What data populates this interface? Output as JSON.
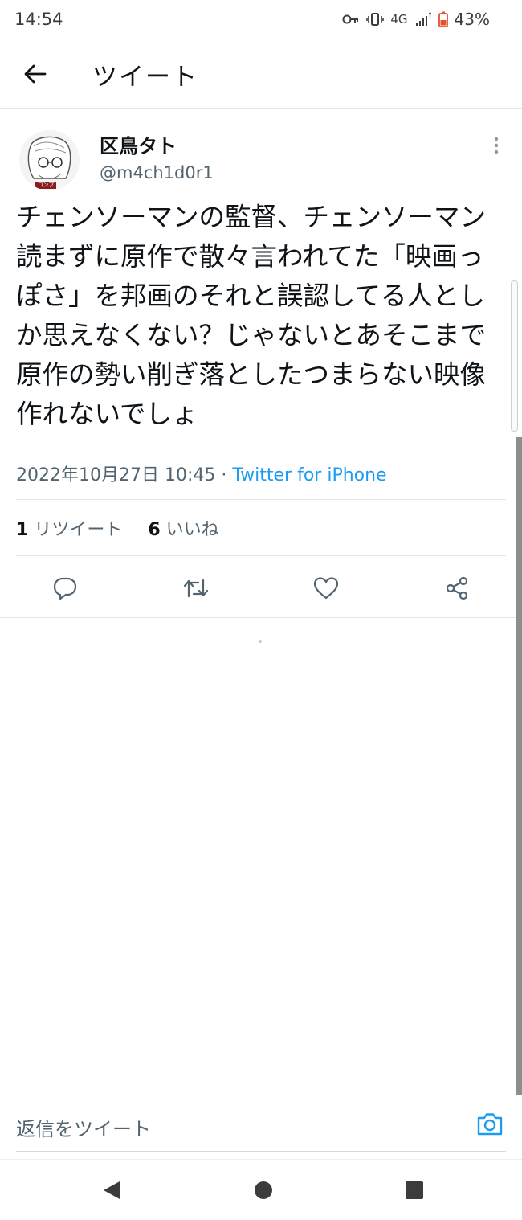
{
  "status_bar": {
    "time": "14:54",
    "network": "4G",
    "battery": "43%",
    "icons": [
      "key-icon",
      "vibrate-icon",
      "signal-icon",
      "battery-icon"
    ]
  },
  "header": {
    "title": "ツイート",
    "back_icon": "arrow-left-icon"
  },
  "tweet": {
    "display_name": "区鳥タト",
    "handle": "@m4ch1d0r1",
    "avatar_badge": "コンプラ",
    "text": "チェンソーマンの監督、チェンソーマン読まずに原作で散々言われてた「映画っぽさ」を邦画のそれと誤認してる人としか思えなくない？じゃないとあそこまで原作の勢い削ぎ落としたつまらない映像作れないでしょ",
    "timestamp": "2022年10月27日 10:45",
    "separator": " · ",
    "source": "Twitter for iPhone",
    "retweet_count": "1",
    "retweet_label": "リツイート",
    "like_count": "6",
    "like_label": "いいね"
  },
  "actions": [
    "reply-icon",
    "retweet-icon",
    "like-icon",
    "share-icon"
  ],
  "reply_bar": {
    "placeholder": "返信をツイート",
    "camera_icon": "camera-icon"
  },
  "nav_bar": {
    "items": [
      "back-triangle-icon",
      "home-circle-icon",
      "recents-square-icon"
    ]
  },
  "colors": {
    "accent": "#1d9bf0",
    "text_primary": "#0f1419",
    "text_secondary": "#536471",
    "battery_low": "#e2532d"
  }
}
